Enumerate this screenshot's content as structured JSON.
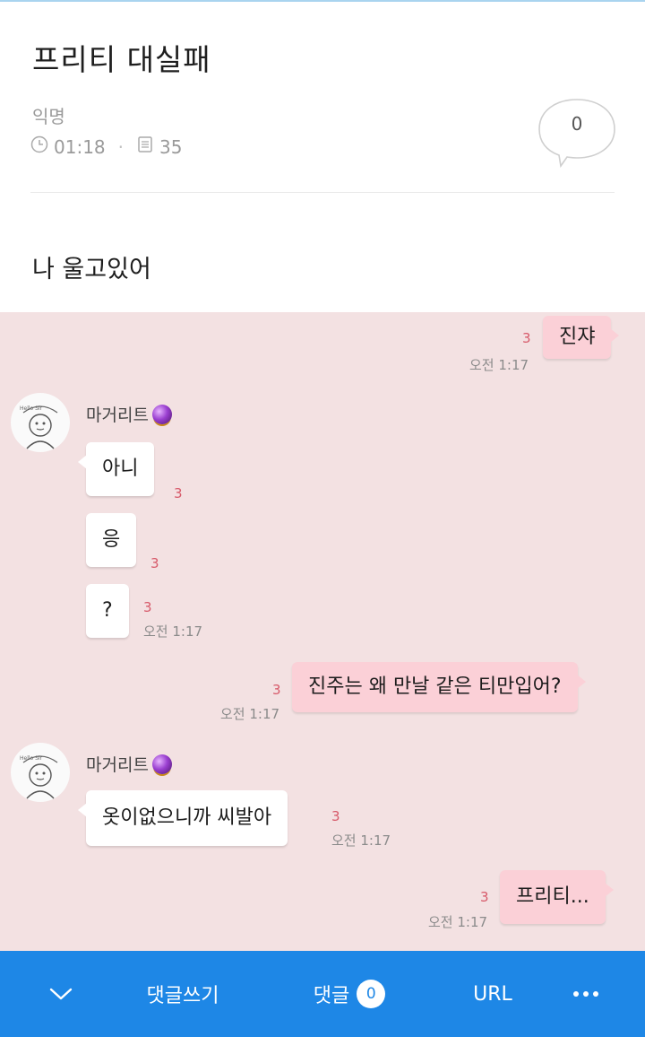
{
  "post": {
    "title": "프리티 대실패",
    "author": "익명",
    "time": "01:18",
    "views": "35",
    "comment_count": "0",
    "body": "나 울고있어"
  },
  "chat": {
    "messages": [
      {
        "side": "me",
        "text": "진쟈",
        "unread": "3",
        "time": "오전 1:17"
      },
      {
        "side": "them",
        "sender": "마거리트",
        "text": "아니",
        "unread": "3"
      },
      {
        "side": "them",
        "text": "응",
        "unread": "3"
      },
      {
        "side": "them",
        "text": "?",
        "unread": "3",
        "time": "오전 1:17"
      },
      {
        "side": "me",
        "text": "진주는 왜 만날 같은 티만입어?",
        "unread": "3",
        "time": "오전 1:17"
      },
      {
        "side": "them",
        "sender": "마거리트",
        "text": "옷이없으니까 씨발아",
        "unread": "3",
        "time": "오전 1:17"
      },
      {
        "side": "me",
        "text": "프리티...",
        "unread": "3",
        "time": "오전 1:17"
      }
    ],
    "colors": {
      "background": "#f3e1e2",
      "my_bubble": "#fbd0d7",
      "their_bubble": "#ffffff",
      "unread": "#d75a6a"
    }
  },
  "toolbar": {
    "collapse_icon": "chevron-down-icon",
    "write_comment": "댓글쓰기",
    "comments_label": "댓글",
    "comments_badge": "0",
    "url_label": "URL",
    "more_icon": "more-horizontal-icon",
    "color": "#1e87e6"
  }
}
